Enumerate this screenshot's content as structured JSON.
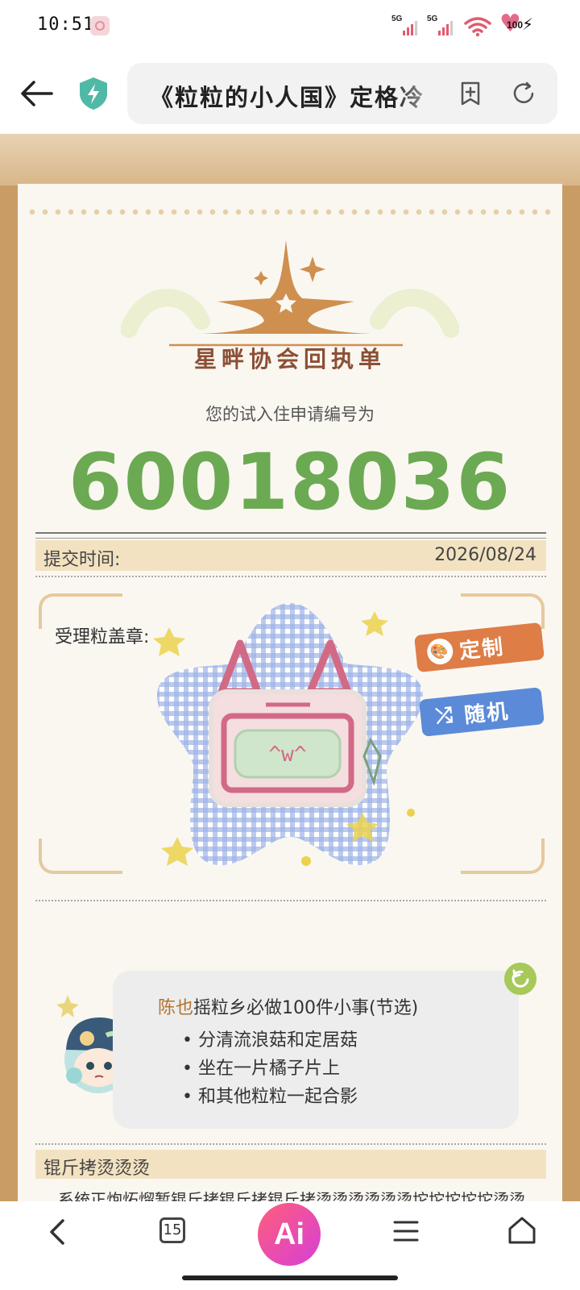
{
  "status_bar": {
    "time": "10:51",
    "signal_1_label": "5G",
    "signal_2_label": "5G",
    "battery": "100",
    "icons": [
      "notification-icon",
      "signal-icon",
      "wifi-icon",
      "battery-icon",
      "charging-icon"
    ]
  },
  "browser": {
    "url_title": "《粒粒的小人国》定格冷",
    "icons": [
      "back-arrow-icon",
      "security-shield-icon",
      "add-bookmark-icon",
      "refresh-icon"
    ]
  },
  "receipt": {
    "logo_title": "星畔协会回执单",
    "apply_label": "您的试入住申请编号为",
    "apply_number": "60018036",
    "submit_label": "提交时间:",
    "submit_date": "2026/08/24",
    "stamp_label": "受理粒盖章:",
    "stamp_face": "^w^",
    "custom_button": "定制",
    "random_button": "随机"
  },
  "todo": {
    "name": "陈也",
    "title_suffix": "摇粒乡必做100件小事(节选)",
    "items": [
      "分清流浪菇和定居菇",
      "坐在一片橘子片上",
      "和其他粒粒一起合影"
    ]
  },
  "section": {
    "title": "锟斤拷烫烫烫",
    "body": "系统正炮炻熘暂锟斤拷锟斤拷锟斤拷烫烫烫烫烫烫坨坨坨坨坨烫烫烫烫锟斤拷锟斤拷屯屯屯烫烫烫铪铪铪锟斤拷锟"
  },
  "nav": {
    "tab_count": "15",
    "ai_label": "Ai"
  },
  "colors": {
    "accent_green": "#6ca953",
    "tag_orange": "#de7d46",
    "tag_blue": "#5b8ad8",
    "wood": "#b6895a"
  }
}
